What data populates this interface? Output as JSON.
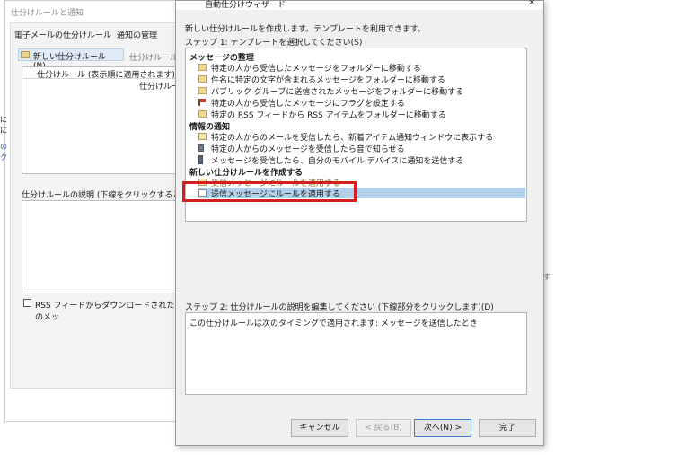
{
  "background_dialog": {
    "title": "仕分けルールと通知",
    "tabs": [
      "電子メールの仕分けルール",
      "通知の管理"
    ],
    "new_rule_button": "新しい仕分けルール(N)...",
    "change_rule_fragment": "仕分けルールの",
    "list_header": "仕分けルール (表示順に適用されます)",
    "list_row": "仕分けルー",
    "description_label": "仕分けルールの説明 (下線をクリックすると編集で",
    "rss_checkbox_label": "RSS フィードからダウンロードされたすべてのメッ",
    "left_fragments": [
      "に",
      "に",
      "の",
      "ク"
    ]
  },
  "stray_text": "す",
  "wizard": {
    "title": "自動仕分けウィザード",
    "close": "✕",
    "intro": "新しい仕分けルールを作成します。テンプレートを利用できます。",
    "step1_label": "ステップ 1: テンプレートを選択してください(S)",
    "groups": [
      {
        "name": "メッセージの整理",
        "items": [
          {
            "text": "特定の人から受信したメッセージをフォルダーに移動する",
            "icon": "folder-icon"
          },
          {
            "text": "件名に特定の文字が含まれるメッセージをフォルダーに移動する",
            "icon": "folder-icon"
          },
          {
            "text": "パブリック グループに送信されたメッセージをフォルダーに移動する",
            "icon": "folder-icon"
          },
          {
            "text": "特定の人から受信したメッセージにフラグを設定する",
            "icon": "flag-icon"
          },
          {
            "text": "特定の RSS フィードから RSS アイテムをフォルダーに移動する",
            "icon": "folder-icon"
          }
        ]
      },
      {
        "name": "情報の通知",
        "items": [
          {
            "text": "特定の人からのメールを受信したら、新着アイテム通知ウィンドウに表示する",
            "icon": "mail-icon"
          },
          {
            "text": "特定の人からのメッセージを受信したら音で知らせる",
            "icon": "sound-icon"
          },
          {
            "text": "メッセージを受信したら、自分のモバイル デバイスに通知を送信する",
            "icon": "phone-icon"
          }
        ]
      },
      {
        "name": "新しい仕分けルールを作成する",
        "items": [
          {
            "text": "受信メッセージにルールを適用する",
            "icon": "mail-icon"
          },
          {
            "text": "送信メッセージにルールを適用する",
            "icon": "envelope-icon",
            "selected": true
          }
        ]
      }
    ],
    "step2_label": "ステップ 2: 仕分けルールの説明を編集してください (下線部分をクリックします)(D)",
    "step2_description": "この仕分けルールは次のタイミングで適用されます: メッセージを送信したとき",
    "buttons": {
      "cancel": "キャンセル",
      "back": "< 戻る(B)",
      "next": "次へ(N) >",
      "finish": "完了"
    }
  },
  "colors": {
    "selection": "#b3d0eb",
    "highlight_box": "#d41f1f",
    "dialog_background": "#f0f0f0"
  }
}
